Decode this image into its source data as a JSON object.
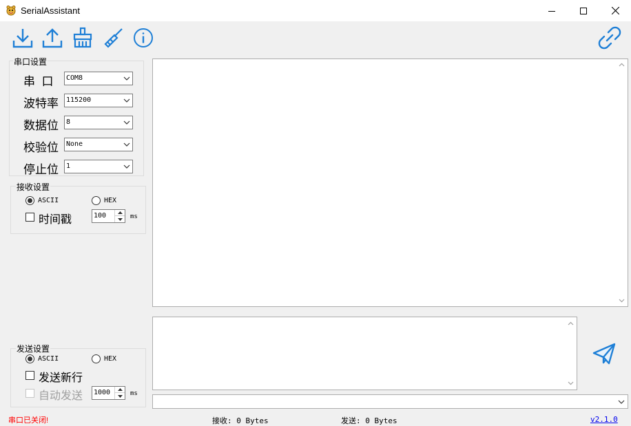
{
  "window": {
    "title": "SerialAssistant",
    "minimize": "—",
    "maximize": "☐",
    "close": "✕"
  },
  "toolbar": {
    "items": [
      {
        "icon": "download-icon"
      },
      {
        "icon": "upload-icon"
      },
      {
        "icon": "clear-icon"
      },
      {
        "icon": "brush-icon"
      },
      {
        "icon": "info-icon"
      }
    ],
    "connect_icon": "link-icon",
    "accent": "#1e7fd6"
  },
  "serial_settings": {
    "title": "串口设置",
    "port_label": "串  口",
    "port_value": "COM8",
    "baud_label": "波特率",
    "baud_value": "115200",
    "databits_label": "数据位",
    "databits_value": "8",
    "parity_label": "校验位",
    "parity_value": "None",
    "stopbits_label": "停止位",
    "stopbits_value": "1"
  },
  "receive_settings": {
    "title": "接收设置",
    "ascii_label": "ASCII",
    "hex_label": "HEX",
    "selected": "ASCII",
    "timestamp_label": "时间戳",
    "timestamp_checked": false,
    "interval_value": "100",
    "interval_unit": "ms"
  },
  "send_settings": {
    "title": "发送设置",
    "ascii_label": "ASCII",
    "hex_label": "HEX",
    "selected": "ASCII",
    "newline_label": "发送新行",
    "newline_checked": false,
    "autosend_label": "自动发送",
    "autosend_checked": false,
    "autosend_enabled": false,
    "interval_value": "1000",
    "interval_unit": "ms"
  },
  "status": {
    "port_state": "串口已关闭!",
    "port_state_color": "#ff0000",
    "received": "接收: 0 Bytes",
    "sent": "发送: 0 Bytes",
    "version": "v2.1.0",
    "version_color": "#0000ee"
  }
}
